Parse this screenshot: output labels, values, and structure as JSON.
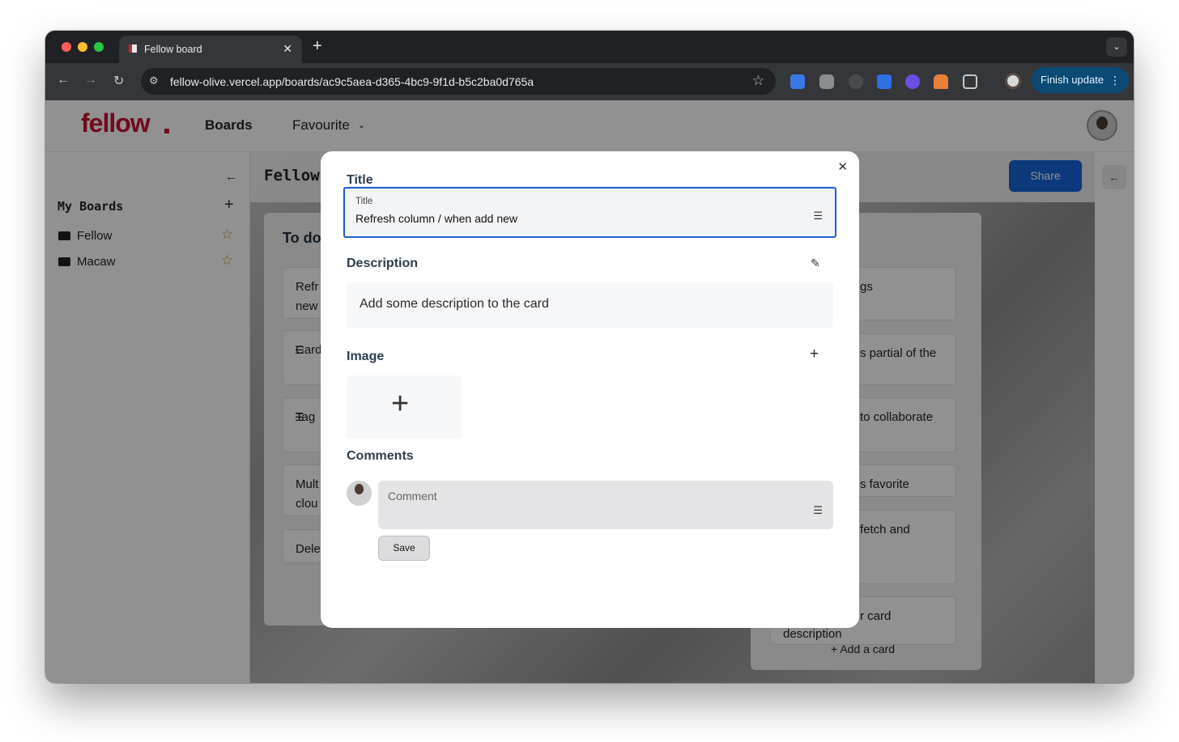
{
  "browser": {
    "tab_title": "Fellow board",
    "tab_close": "✕",
    "new_tab": "+",
    "url": "fellow-olive.vercel.app/boards/ac9c5aea-d365-4bc9-9f1d-b5c2ba0d765a",
    "finish_update": "Finish update",
    "colors": {
      "red": "#ff5f57",
      "yellow": "#febc2e",
      "green": "#28c840"
    }
  },
  "header": {
    "logo": "fellow",
    "nav_boards": "Boards",
    "nav_favourite": "Favourite"
  },
  "sidebar": {
    "title": "My Boards",
    "items": [
      {
        "label": "Fellow"
      },
      {
        "label": "Macaw"
      }
    ]
  },
  "board": {
    "title": "Fellow",
    "share_label": "Share",
    "column_title": "To do",
    "left_cards": [
      "Refr",
      "new",
      "Card",
      "Tag",
      "Mult",
      "clou",
      "Dele"
    ],
    "right_cards": [
      "gs",
      "s partial of the",
      "to collaborate",
      "s favorite",
      "fetch and",
      "r card",
      "description"
    ],
    "add_card": "Add a card"
  },
  "modal": {
    "title_heading": "Title",
    "title_field_label": "Title",
    "title_value": "Refresh column / when add new",
    "description_heading": "Description",
    "description_placeholder": "Add some description to the card",
    "image_heading": "Image",
    "comments_heading": "Comments",
    "comment_placeholder": "Comment",
    "save_label": "Save"
  }
}
